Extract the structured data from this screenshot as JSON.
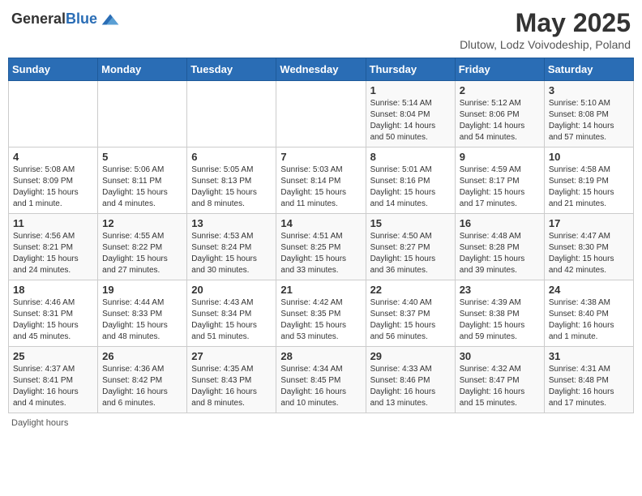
{
  "header": {
    "logo_general": "General",
    "logo_blue": "Blue",
    "month": "May 2025",
    "location": "Dlutow, Lodz Voivodeship, Poland"
  },
  "days_of_week": [
    "Sunday",
    "Monday",
    "Tuesday",
    "Wednesday",
    "Thursday",
    "Friday",
    "Saturday"
  ],
  "footer": {
    "daylight_hours": "Daylight hours"
  },
  "weeks": [
    [
      {
        "day": "",
        "info": ""
      },
      {
        "day": "",
        "info": ""
      },
      {
        "day": "",
        "info": ""
      },
      {
        "day": "",
        "info": ""
      },
      {
        "day": "1",
        "info": "Sunrise: 5:14 AM\nSunset: 8:04 PM\nDaylight: 14 hours\nand 50 minutes."
      },
      {
        "day": "2",
        "info": "Sunrise: 5:12 AM\nSunset: 8:06 PM\nDaylight: 14 hours\nand 54 minutes."
      },
      {
        "day": "3",
        "info": "Sunrise: 5:10 AM\nSunset: 8:08 PM\nDaylight: 14 hours\nand 57 minutes."
      }
    ],
    [
      {
        "day": "4",
        "info": "Sunrise: 5:08 AM\nSunset: 8:09 PM\nDaylight: 15 hours\nand 1 minute."
      },
      {
        "day": "5",
        "info": "Sunrise: 5:06 AM\nSunset: 8:11 PM\nDaylight: 15 hours\nand 4 minutes."
      },
      {
        "day": "6",
        "info": "Sunrise: 5:05 AM\nSunset: 8:13 PM\nDaylight: 15 hours\nand 8 minutes."
      },
      {
        "day": "7",
        "info": "Sunrise: 5:03 AM\nSunset: 8:14 PM\nDaylight: 15 hours\nand 11 minutes."
      },
      {
        "day": "8",
        "info": "Sunrise: 5:01 AM\nSunset: 8:16 PM\nDaylight: 15 hours\nand 14 minutes."
      },
      {
        "day": "9",
        "info": "Sunrise: 4:59 AM\nSunset: 8:17 PM\nDaylight: 15 hours\nand 17 minutes."
      },
      {
        "day": "10",
        "info": "Sunrise: 4:58 AM\nSunset: 8:19 PM\nDaylight: 15 hours\nand 21 minutes."
      }
    ],
    [
      {
        "day": "11",
        "info": "Sunrise: 4:56 AM\nSunset: 8:21 PM\nDaylight: 15 hours\nand 24 minutes."
      },
      {
        "day": "12",
        "info": "Sunrise: 4:55 AM\nSunset: 8:22 PM\nDaylight: 15 hours\nand 27 minutes."
      },
      {
        "day": "13",
        "info": "Sunrise: 4:53 AM\nSunset: 8:24 PM\nDaylight: 15 hours\nand 30 minutes."
      },
      {
        "day": "14",
        "info": "Sunrise: 4:51 AM\nSunset: 8:25 PM\nDaylight: 15 hours\nand 33 minutes."
      },
      {
        "day": "15",
        "info": "Sunrise: 4:50 AM\nSunset: 8:27 PM\nDaylight: 15 hours\nand 36 minutes."
      },
      {
        "day": "16",
        "info": "Sunrise: 4:48 AM\nSunset: 8:28 PM\nDaylight: 15 hours\nand 39 minutes."
      },
      {
        "day": "17",
        "info": "Sunrise: 4:47 AM\nSunset: 8:30 PM\nDaylight: 15 hours\nand 42 minutes."
      }
    ],
    [
      {
        "day": "18",
        "info": "Sunrise: 4:46 AM\nSunset: 8:31 PM\nDaylight: 15 hours\nand 45 minutes."
      },
      {
        "day": "19",
        "info": "Sunrise: 4:44 AM\nSunset: 8:33 PM\nDaylight: 15 hours\nand 48 minutes."
      },
      {
        "day": "20",
        "info": "Sunrise: 4:43 AM\nSunset: 8:34 PM\nDaylight: 15 hours\nand 51 minutes."
      },
      {
        "day": "21",
        "info": "Sunrise: 4:42 AM\nSunset: 8:35 PM\nDaylight: 15 hours\nand 53 minutes."
      },
      {
        "day": "22",
        "info": "Sunrise: 4:40 AM\nSunset: 8:37 PM\nDaylight: 15 hours\nand 56 minutes."
      },
      {
        "day": "23",
        "info": "Sunrise: 4:39 AM\nSunset: 8:38 PM\nDaylight: 15 hours\nand 59 minutes."
      },
      {
        "day": "24",
        "info": "Sunrise: 4:38 AM\nSunset: 8:40 PM\nDaylight: 16 hours\nand 1 minute."
      }
    ],
    [
      {
        "day": "25",
        "info": "Sunrise: 4:37 AM\nSunset: 8:41 PM\nDaylight: 16 hours\nand 4 minutes."
      },
      {
        "day": "26",
        "info": "Sunrise: 4:36 AM\nSunset: 8:42 PM\nDaylight: 16 hours\nand 6 minutes."
      },
      {
        "day": "27",
        "info": "Sunrise: 4:35 AM\nSunset: 8:43 PM\nDaylight: 16 hours\nand 8 minutes."
      },
      {
        "day": "28",
        "info": "Sunrise: 4:34 AM\nSunset: 8:45 PM\nDaylight: 16 hours\nand 10 minutes."
      },
      {
        "day": "29",
        "info": "Sunrise: 4:33 AM\nSunset: 8:46 PM\nDaylight: 16 hours\nand 13 minutes."
      },
      {
        "day": "30",
        "info": "Sunrise: 4:32 AM\nSunset: 8:47 PM\nDaylight: 16 hours\nand 15 minutes."
      },
      {
        "day": "31",
        "info": "Sunrise: 4:31 AM\nSunset: 8:48 PM\nDaylight: 16 hours\nand 17 minutes."
      }
    ]
  ]
}
